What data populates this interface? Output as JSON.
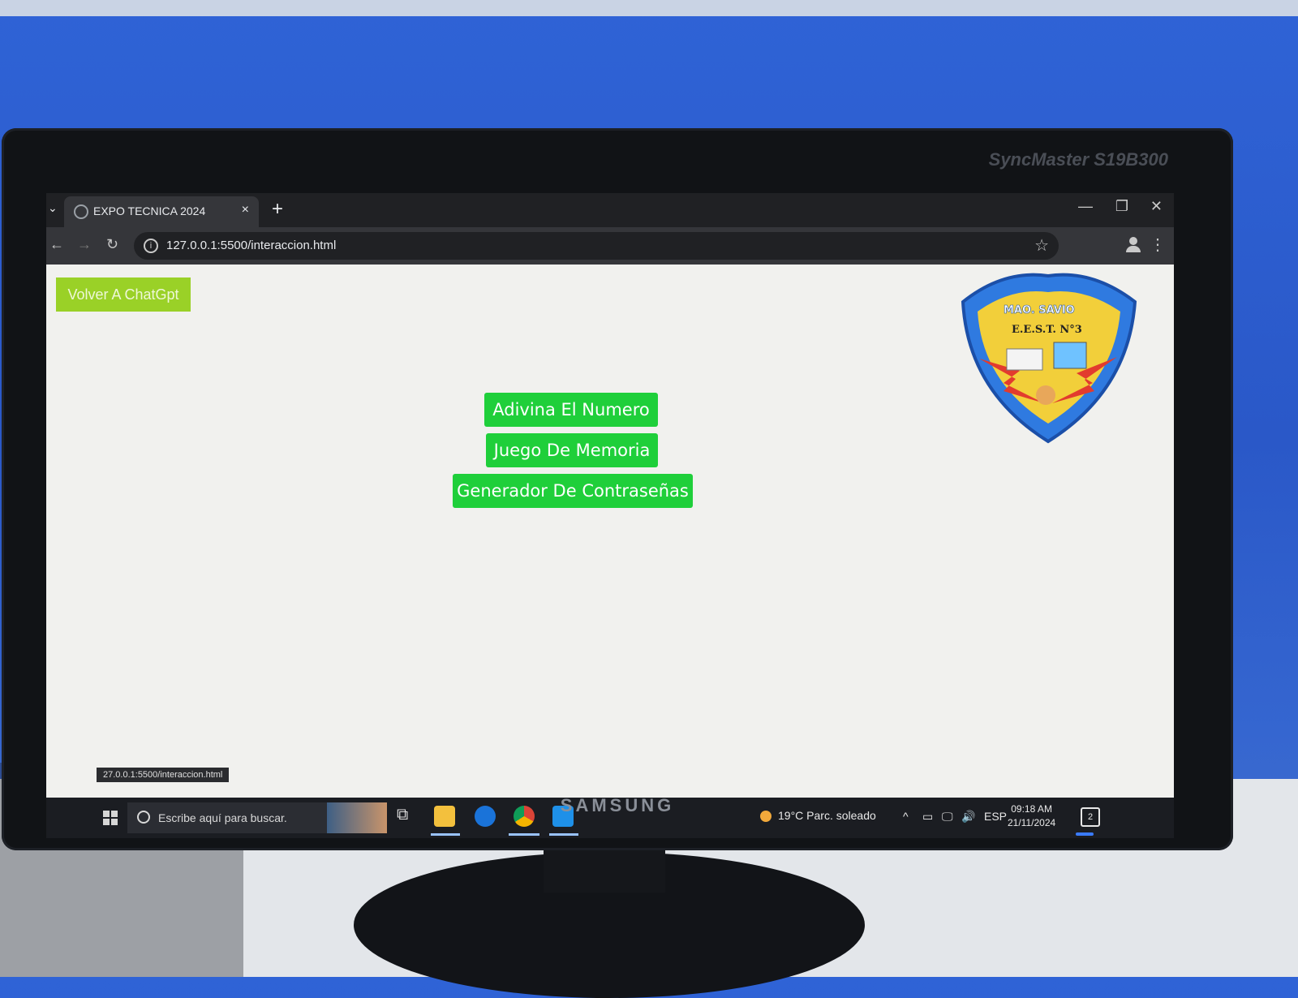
{
  "monitor": {
    "model": "SyncMaster S19B300",
    "brand": "SAMSUNG"
  },
  "browser": {
    "tab_title": "EXPO TECNICA 2024",
    "tab_close": "×",
    "new_tab": "+",
    "url": "127.0.0.1:5500/interaccion.html",
    "status_url": "27.0.0.1:5500/interaccion.html"
  },
  "page": {
    "back_button": "Volver A ChatGpt",
    "buttons": [
      "Adivina El Numero",
      "Juego De Memoria",
      "Generador De Contraseñas"
    ],
    "logo": {
      "line1": "MAO. SAVIO",
      "line2": "E.E.S.T. N°3"
    }
  },
  "taskbar": {
    "search_placeholder": "Escribe aquí para buscar.",
    "weather": "19°C  Parc. soleado",
    "language": "ESP",
    "time": "09:18 AM",
    "date": "21/11/2024",
    "notifications": "2"
  },
  "colors": {
    "button_green": "#1fcf3a",
    "back_button_green": "#9ad127",
    "logo_blue": "#2f7ae0",
    "logo_yellow": "#f2cf3a"
  }
}
